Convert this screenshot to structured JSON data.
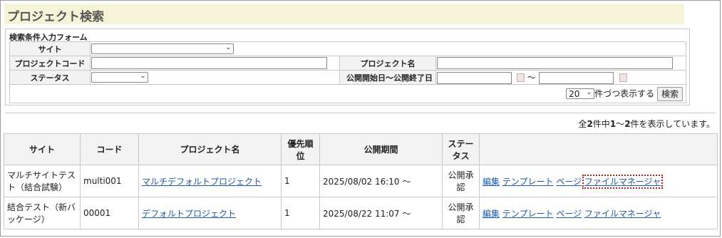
{
  "page_title": "プロジェクト検索",
  "form": {
    "caption": "検索条件入力フォーム",
    "site_label": "サイト",
    "site_value": "",
    "code_label": "プロジェクトコード",
    "code_value": "",
    "name_label": "プロジェクト名",
    "name_value": "",
    "status_label": "ステータス",
    "status_value": "",
    "period_label": "公開開始日～公開終了日",
    "period_start": "",
    "period_tilde": "～",
    "period_end": "",
    "per_page_value": "20",
    "per_page_suffix": "件づつ表示する",
    "search_button": "検索"
  },
  "result_count": {
    "prefix": "全",
    "total": "2",
    "mid1": "件中",
    "from": "1",
    "tilde": "～",
    "to": "2",
    "suffix": "件を表示しています。"
  },
  "table": {
    "headers": [
      "サイト",
      "コード",
      "プロジェクト名",
      "優先順位",
      "公開期間",
      "ステータス",
      ""
    ],
    "headers_split": {
      "priority_1": "優先順",
      "priority_2": "位",
      "status_1": "ステー",
      "status_2": "タス"
    },
    "rows": [
      {
        "site_1": "マルチサイトテス",
        "site_2": "ト（結合試験）",
        "code": "multi001",
        "name": "マルチデフォルトプロジェクト",
        "priority": "1",
        "period": "2025/08/02 16:10 ～",
        "status_1": "公開承",
        "status_2": "認",
        "actions": [
          "編集",
          "テンプレート",
          "ページ",
          "ファイルマネージャ"
        ]
      },
      {
        "site_1": "結合テスト（新バ",
        "site_2": "ッケージ）",
        "code": "00001",
        "name": "デフォルトプロジェクト",
        "priority": "1",
        "period": "2025/08/22 11:07 ～",
        "status_1": "公開承",
        "status_2": "認",
        "actions": [
          "編集",
          "テンプレート",
          "ページ",
          "ファイルマネージャ"
        ]
      }
    ]
  }
}
